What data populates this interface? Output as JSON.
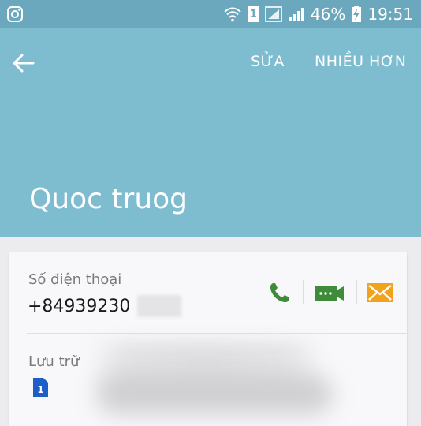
{
  "status_bar": {
    "battery_percent": "46%",
    "time": "19:51",
    "sim_slot": "1"
  },
  "toolbar": {
    "edit_label": "SỬA",
    "more_label": "NHIỀU HƠN"
  },
  "contact": {
    "name": "Quoc truog",
    "phone_label": "Số điện thoại",
    "phone_number": "+84939230",
    "storage_label": "Lưu trữ",
    "storage_sim": "1"
  },
  "colors": {
    "status_bar": "#6ba8bd",
    "header": "#7ebcd0",
    "call_green": "#3f8b3a",
    "video_green": "#3f8b3a",
    "message_orange": "#f2a31d",
    "sim_blue": "#1d5fc6"
  },
  "icons": {
    "status_left": "instagram-icon",
    "wifi": "wifi-icon",
    "signal_1": "signal-icon",
    "signal_2": "signal-icon",
    "battery": "battery-charging-icon",
    "back": "arrow-left-icon",
    "call": "phone-icon",
    "video": "video-call-icon",
    "message": "envelope-icon",
    "storage": "sim-card-icon"
  }
}
